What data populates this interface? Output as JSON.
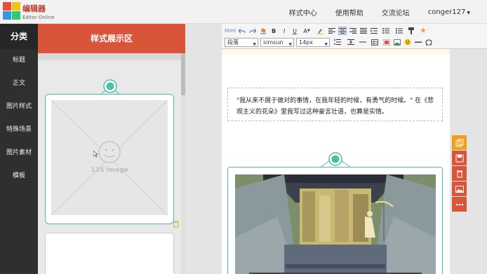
{
  "brand": {
    "name_cn": "编辑器",
    "name_en": "Editor Online"
  },
  "nav": {
    "items": [
      {
        "label": "样式中心"
      },
      {
        "label": "使用帮助"
      },
      {
        "label": "交流论坛"
      }
    ],
    "user": "conger127"
  },
  "sidebar": {
    "title": "分类",
    "items": [
      {
        "label": "标题"
      },
      {
        "label": "正文"
      },
      {
        "label": "图片样式"
      },
      {
        "label": "特殊场景"
      },
      {
        "label": "图片素材"
      },
      {
        "label": "模板"
      }
    ]
  },
  "style_panel": {
    "title": "样式展示区",
    "placeholder_text": "135 image"
  },
  "toolbar": {
    "row1": [
      "html",
      "undo",
      "redo",
      "eraser",
      "B",
      "I",
      "U",
      "A",
      "highlight",
      "align-left",
      "align-center",
      "align-right",
      "justify",
      "indent",
      "list-bullet",
      "list-number",
      "format-painter",
      "magic"
    ],
    "paragraph": "段落",
    "font_family": "simsun",
    "font_size": "14px"
  },
  "editor": {
    "quote_text": "\"我从来不屑于做对的事情，在我年轻的时候，有勇气的时候。\" 在《悲观主义的花朵》里我写过这种豪言壮语，也算是实情。"
  },
  "colors": {
    "accent": "#d8553a",
    "teal": "#4cbfa6",
    "orange": "#f0a020",
    "sidebar": "#2f2f2f"
  }
}
